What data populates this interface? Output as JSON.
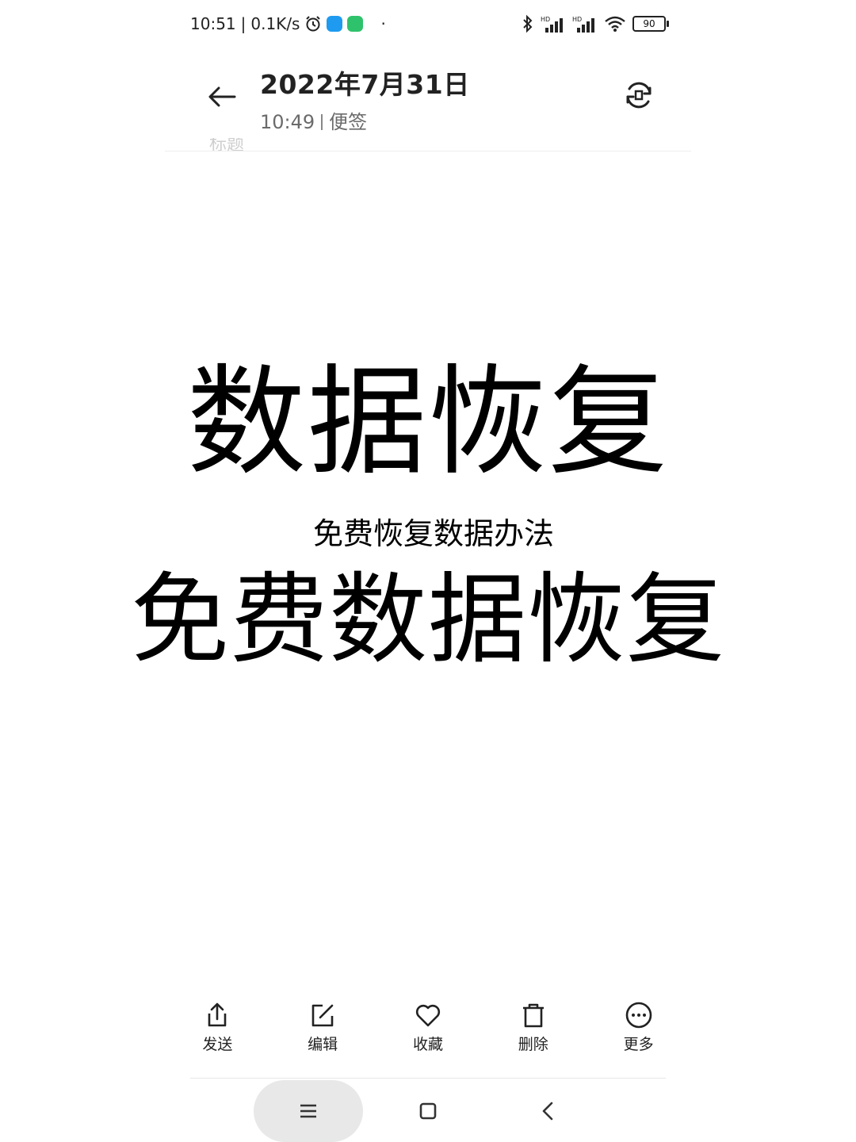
{
  "status_bar": {
    "time": "10:51",
    "separator": "|",
    "network_speed": "0.1K/s",
    "dot": "·",
    "battery": "90",
    "icons": [
      "alarm-icon",
      "cloud-app-icon",
      "green-app-icon",
      "bluetooth-icon",
      "hd-signal-icon",
      "hd-signal-2-icon",
      "wifi-icon",
      "battery-icon"
    ]
  },
  "header": {
    "date": "2022年7月31日",
    "time": "10:49",
    "category": "便签"
  },
  "note": {
    "faded_title": "标题",
    "big_title": "数据恢复",
    "subtitle": "免费恢复数据办法",
    "big_title_2": "免费数据恢复"
  },
  "toolbar": {
    "items": [
      {
        "label": "发送",
        "icon": "share-icon"
      },
      {
        "label": "编辑",
        "icon": "edit-icon"
      },
      {
        "label": "收藏",
        "icon": "heart-icon"
      },
      {
        "label": "删除",
        "icon": "trash-icon"
      },
      {
        "label": "更多",
        "icon": "more-icon"
      }
    ]
  },
  "nav_bar": {
    "buttons": [
      "menu-icon",
      "home-icon",
      "back-icon"
    ]
  },
  "colors": {
    "background": "#ffffff",
    "text": "#000000",
    "secondary_text": "#6b6b6b",
    "nav_pill": "#e8e8e8"
  }
}
